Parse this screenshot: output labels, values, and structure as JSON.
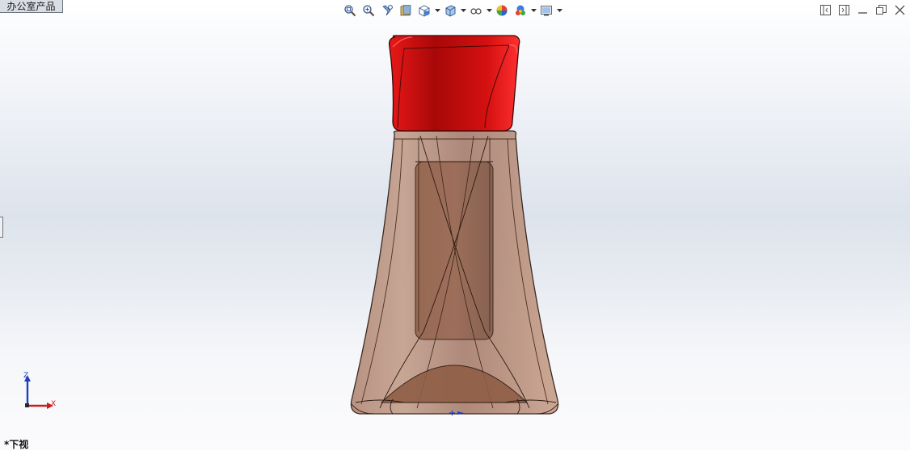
{
  "tab": {
    "label": "办公室产品"
  },
  "toolbar": {
    "items": [
      {
        "name": "zoom-to-fit-icon"
      },
      {
        "name": "zoom-to-area-icon"
      },
      {
        "name": "previous-view-icon"
      },
      {
        "name": "section-view-icon"
      },
      {
        "name": "view-orientation-icon",
        "dropdown": true
      },
      {
        "name": "display-style-icon",
        "dropdown": true
      },
      {
        "name": "hide-show-items-icon",
        "dropdown": true
      },
      {
        "name": "edit-appearance-icon"
      },
      {
        "name": "apply-scene-icon",
        "dropdown": true
      },
      {
        "name": "view-settings-icon",
        "dropdown": true
      }
    ]
  },
  "window_controls": [
    "tile-left-icon",
    "tile-right-icon",
    "minimize-icon",
    "restore-icon",
    "close-icon"
  ],
  "triad": {
    "z_label": "Z",
    "x_label": "X"
  },
  "view": {
    "label": "*下视"
  },
  "colors": {
    "cap": "#d40f0f",
    "body": "#a97d68",
    "edge": "#2b1a12",
    "triad_z": "#1f3fbf",
    "triad_x": "#c41f1f"
  }
}
